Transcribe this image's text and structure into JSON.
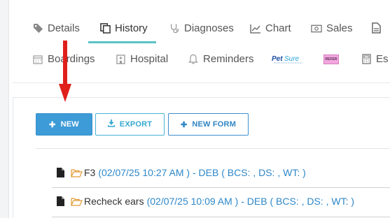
{
  "tabs_row1": [
    {
      "label": "Details",
      "icon": "tag-icon"
    },
    {
      "label": "History",
      "icon": "copy-icon",
      "active": true
    },
    {
      "label": "Diagnoses",
      "icon": "stethoscope-icon"
    },
    {
      "label": "Chart",
      "icon": "line-chart-icon"
    },
    {
      "label": "Sales",
      "icon": "money-icon"
    }
  ],
  "tabs_row2": [
    {
      "label": "Boardings",
      "icon": "calendar-icon"
    },
    {
      "label": "Hospital",
      "icon": "hospital-icon"
    },
    {
      "label": "Reminders",
      "icon": "bell-icon"
    },
    {
      "label": "Es",
      "icon": "calculator-icon"
    }
  ],
  "logos": {
    "petsure_text": "PetSure",
    "pink_badge_text": "REFER"
  },
  "buttons": {
    "new_label": "NEW",
    "export_label": "EXPORT",
    "new_form_label": "NEW FORM"
  },
  "entries": [
    {
      "title": "F3",
      "meta": "(02/07/25 10:27 AM ) - DEB ( BCS: , DS: , WT: )"
    },
    {
      "title": "Recheck ears",
      "meta": "(02/07/25 10:09 AM ) - DEB ( BCS: , DS: , WT: )"
    }
  ],
  "colors": {
    "accent_teal": "#5bc3c7",
    "primary_blue": "#3d9bd8",
    "link_blue": "#2e87c8",
    "arrow_red": "#e0201b"
  }
}
